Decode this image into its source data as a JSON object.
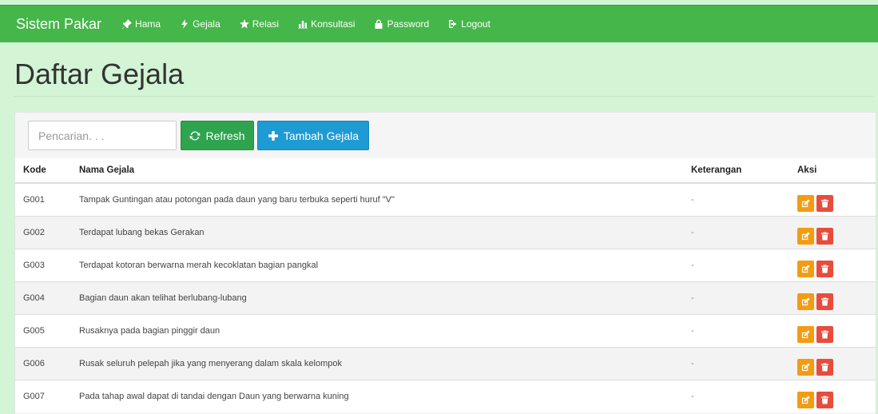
{
  "navbar": {
    "brand": "Sistem Pakar",
    "items": [
      {
        "label": "Hama",
        "icon": "pushpin-icon"
      },
      {
        "label": "Gejala",
        "icon": "flash-icon"
      },
      {
        "label": "Relasi",
        "icon": "star-icon"
      },
      {
        "label": "Konsultasi",
        "icon": "stats-icon"
      },
      {
        "label": "Password",
        "icon": "lock-icon"
      },
      {
        "label": "Logout",
        "icon": "logout-icon"
      }
    ]
  },
  "page": {
    "title": "Daftar Gejala"
  },
  "toolbar": {
    "search_placeholder": "Pencarian. . .",
    "refresh_label": "Refresh",
    "add_label": "Tambah Gejala"
  },
  "table": {
    "headers": {
      "kode": "Kode",
      "nama": "Nama Gejala",
      "keterangan": "Keterangan",
      "aksi": "Aksi"
    },
    "rows": [
      {
        "kode": "G001",
        "nama": "Tampak Guntingan atau potongan pada daun yang baru terbuka seperti huruf \"V\"",
        "keterangan": "-"
      },
      {
        "kode": "G002",
        "nama": "Terdapat lubang bekas Gerakan",
        "keterangan": "-"
      },
      {
        "kode": "G003",
        "nama": "Terdapat kotoran berwarna merah kecoklatan bagian pangkal",
        "keterangan": "-"
      },
      {
        "kode": "G004",
        "nama": "Bagian daun akan telihat berlubang-lubang",
        "keterangan": "-"
      },
      {
        "kode": "G005",
        "nama": "Rusaknya pada bagian pinggir daun",
        "keterangan": "-"
      },
      {
        "kode": "G006",
        "nama": "Rusak seluruh pelepah jika yang menyerang dalam skala kelompok",
        "keterangan": "-"
      },
      {
        "kode": "G007",
        "nama": "Pada tahap awal dapat di tandai dengan Daun yang berwarna kuning",
        "keterangan": "-"
      }
    ]
  },
  "colors": {
    "navbar": "#45b649",
    "background": "#d3f5d6",
    "refresh": "#2ea44f",
    "add": "#1e9bd3",
    "edit": "#f39c12",
    "delete": "#e74c3c"
  }
}
